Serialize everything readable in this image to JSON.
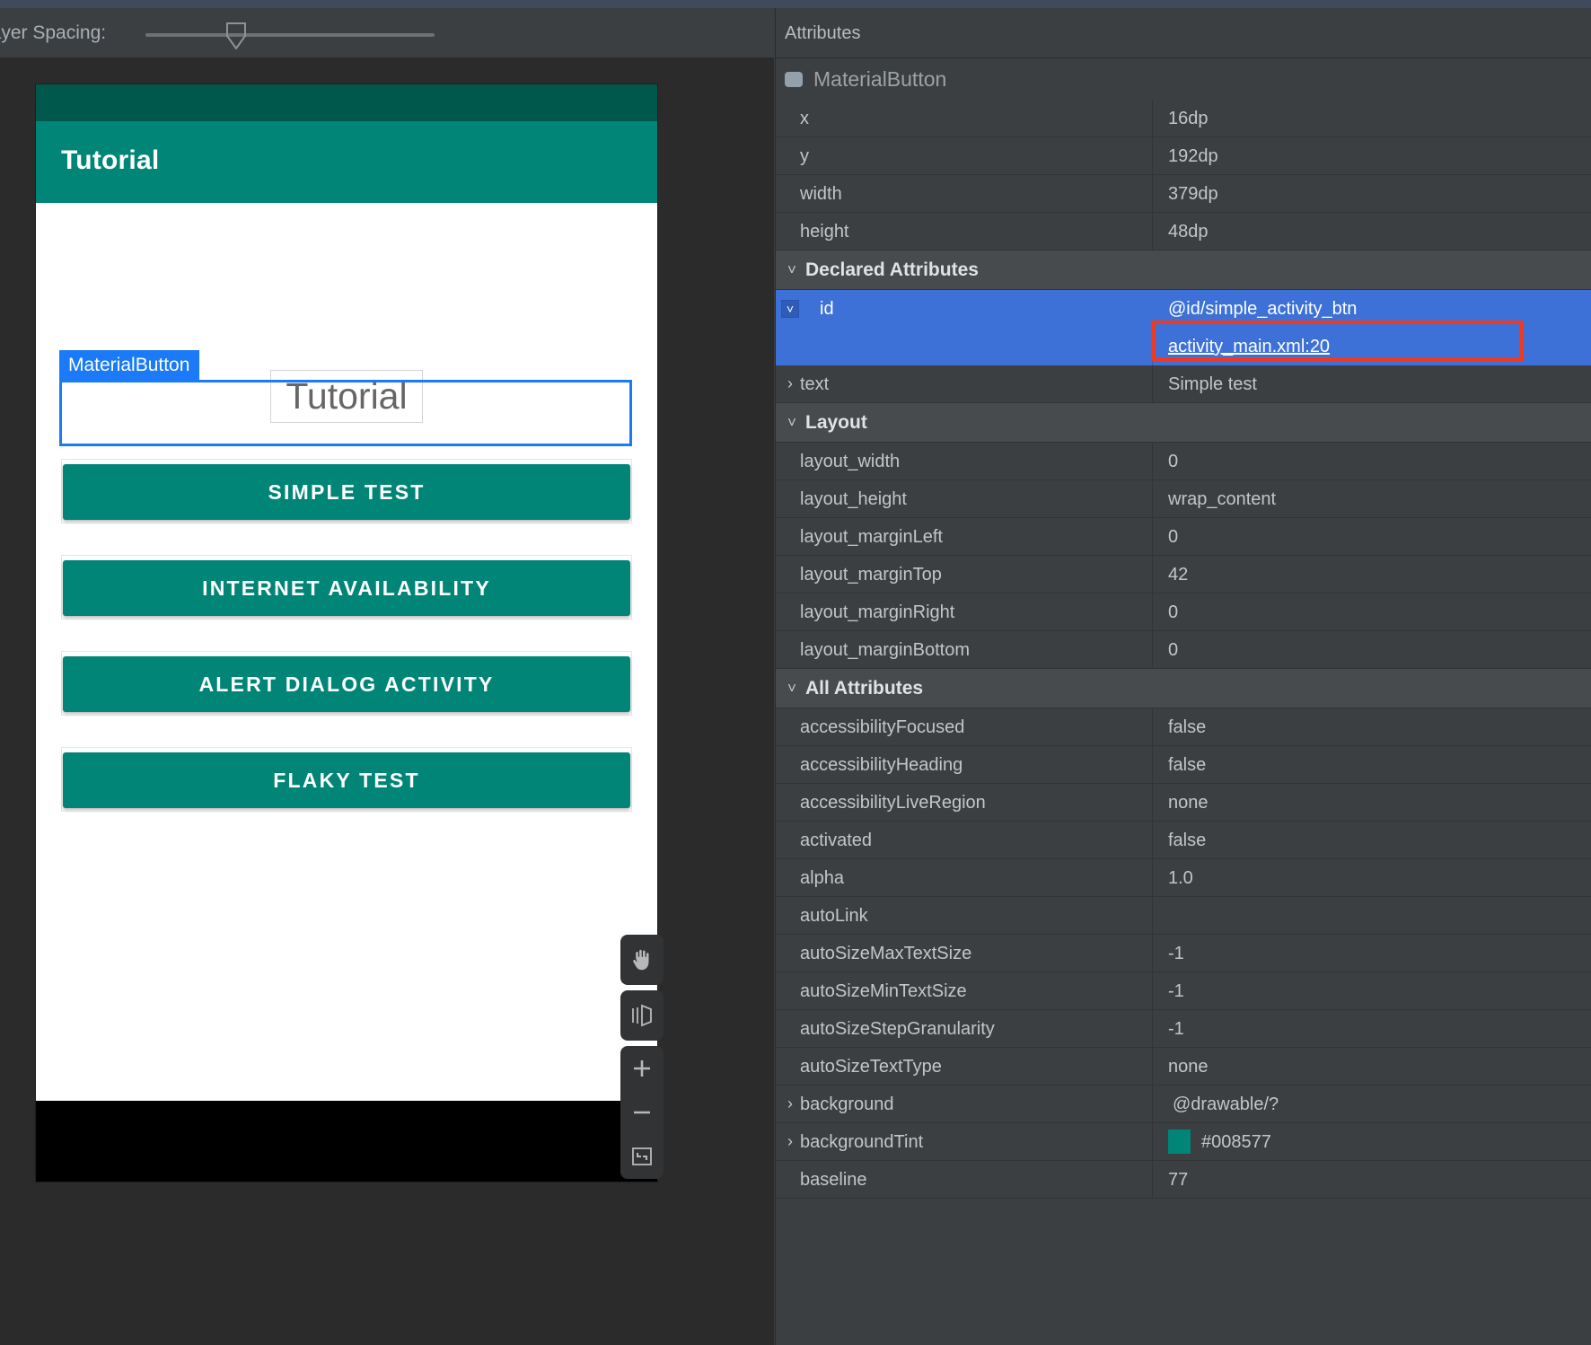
{
  "theme": {
    "accent_teal": "#008577",
    "accent_teal_dark": "#00574b",
    "selection_blue": "#3d71d8",
    "tag_blue": "#1a7af8",
    "annotation_red": "#f03a20",
    "panel_bg": "#3c3f41"
  },
  "design_toolbar": {
    "layer_spacing_label": "Layer Spacing:",
    "slider_value_percent": 30
  },
  "device_preview": {
    "app_bar_title": "Tutorial",
    "textview_label": "Tutorial",
    "selection_tag": "MaterialButton",
    "buttons": [
      {
        "label": "SIMPLE TEST",
        "selected": true
      },
      {
        "label": "INTERNET AVAILABILITY",
        "selected": false
      },
      {
        "label": "ALERT DIALOG ACTIVITY",
        "selected": false
      },
      {
        "label": "FLAKY TEST",
        "selected": false
      }
    ],
    "canvas_controls": [
      {
        "icon": "pan-hand-icon",
        "name": "pan-tool"
      },
      {
        "icon": "perspective-icon",
        "name": "toggle-perspective"
      },
      {
        "icon": "plus-icon",
        "name": "zoom-in"
      },
      {
        "icon": "minus-icon",
        "name": "zoom-out"
      },
      {
        "icon": "fit-screen-icon",
        "name": "zoom-to-fit"
      }
    ]
  },
  "attributes_panel": {
    "header_title": "Attributes",
    "component_name": "MaterialButton",
    "component_icon": "material-button-icon",
    "dimension_rows": [
      {
        "key": "x",
        "value": "16dp"
      },
      {
        "key": "y",
        "value": "192dp"
      },
      {
        "key": "width",
        "value": "379dp"
      },
      {
        "key": "height",
        "value": "48dp"
      }
    ],
    "sections": [
      {
        "title": "Declared Attributes",
        "expanded": true,
        "rows": [
          {
            "key": "id",
            "value": "@id/simple_activity_btn",
            "expander": "v",
            "selected": true,
            "sub_value": "activity_main.xml:20",
            "annotated": true
          },
          {
            "key": "text",
            "value": "Simple test",
            "expander": ">"
          }
        ]
      },
      {
        "title": "Layout",
        "expanded": true,
        "rows": [
          {
            "key": "layout_width",
            "value": "0"
          },
          {
            "key": "layout_height",
            "value": "wrap_content"
          },
          {
            "key": "layout_marginLeft",
            "value": "0"
          },
          {
            "key": "layout_marginTop",
            "value": "42"
          },
          {
            "key": "layout_marginRight",
            "value": "0"
          },
          {
            "key": "layout_marginBottom",
            "value": "0"
          }
        ]
      },
      {
        "title": "All Attributes",
        "expanded": true,
        "rows": [
          {
            "key": "accessibilityFocused",
            "value": "false"
          },
          {
            "key": "accessibilityHeading",
            "value": "false"
          },
          {
            "key": "accessibilityLiveRegion",
            "value": "none"
          },
          {
            "key": "activated",
            "value": "false"
          },
          {
            "key": "alpha",
            "value": "1.0"
          },
          {
            "key": "autoLink",
            "value": ""
          },
          {
            "key": "autoSizeMaxTextSize",
            "value": "-1"
          },
          {
            "key": "autoSizeMinTextSize",
            "value": "-1"
          },
          {
            "key": "autoSizeStepGranularity",
            "value": "-1"
          },
          {
            "key": "autoSizeTextType",
            "value": "none"
          },
          {
            "key": "background",
            "value": "@drawable/?",
            "expander": ">"
          },
          {
            "key": "backgroundTint",
            "value": "#008577",
            "expander": ">",
            "swatch": "#008577"
          },
          {
            "key": "baseline",
            "value": "77"
          }
        ]
      }
    ]
  }
}
